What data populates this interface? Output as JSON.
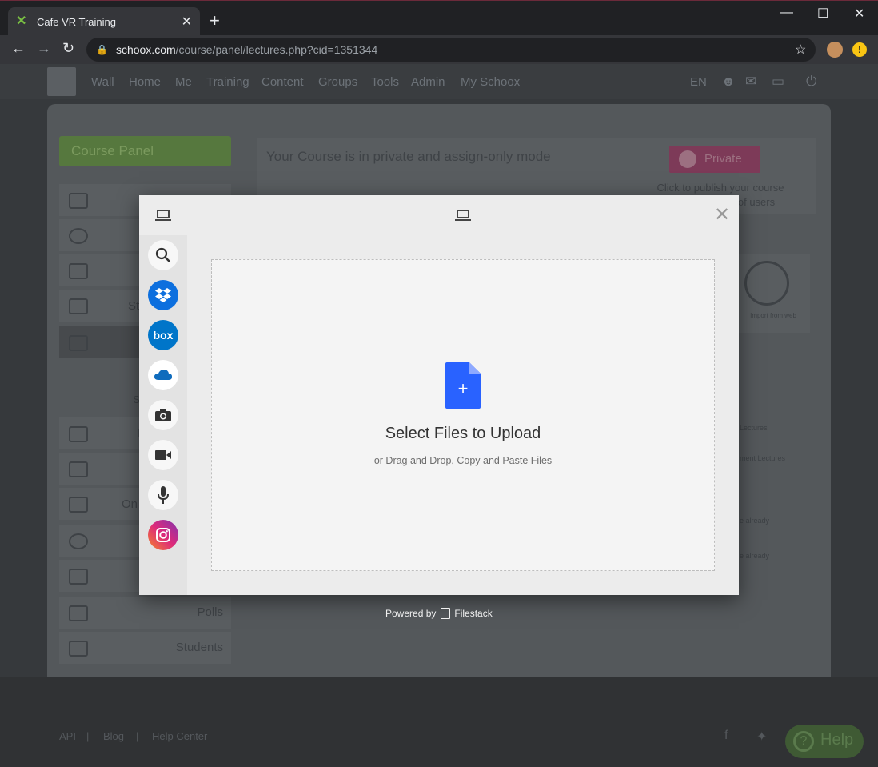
{
  "browser": {
    "tab_title": "Cafe VR Training",
    "tab_favicon": "x-favicon",
    "url_host": "schoox.com",
    "url_path": "/course/panel/lectures.php?cid=1351344"
  },
  "site": {
    "nav": [
      "Wall",
      "Home",
      "Me",
      "Training",
      "Content",
      "Groups",
      "Tools",
      "Admin",
      "My Schoox"
    ],
    "lang": "EN",
    "course_panel_label": "Course Panel",
    "sidebar": {
      "steps_label": "Ste",
      "support_label": "Supp",
      "on_label": "On t",
      "in_label": "I",
      "polls": "Polls",
      "students": "Students"
    },
    "notice": {
      "text": "Your Course is in private and assign-only mode",
      "private_button": "Private",
      "click_hint": "Click to publish your course",
      "click_hint2": "of users"
    },
    "import_web": "Import from web",
    "lectures": "Lectures",
    "ment_lectures": "ment Lectures",
    "already1": "e already",
    "already2": "e already",
    "footer": {
      "api": "API",
      "sep1": "|",
      "blog": "Blog",
      "sep2": "|",
      "help_center": "Help Center",
      "help_button": "Help"
    }
  },
  "modal": {
    "drop_title": "Select Files to Upload",
    "drop_subtitle": "or Drag and Drop, Copy and Paste Files",
    "sources": [
      "search-icon",
      "dropbox-icon",
      "box-icon",
      "onedrive-icon",
      "camera-icon",
      "video-icon",
      "microphone-icon",
      "instagram-icon"
    ],
    "box_label": "box",
    "powered_by": "Powered by",
    "brand": "Filestack"
  }
}
